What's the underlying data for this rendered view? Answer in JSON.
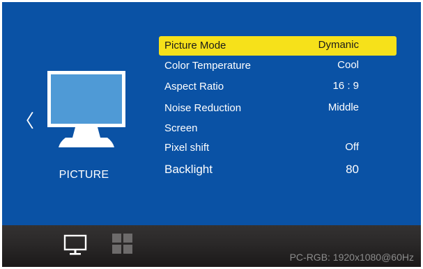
{
  "nav": {
    "back_glyph": "〈"
  },
  "category": {
    "label": "PICTURE",
    "icon": "monitor-icon"
  },
  "menu": [
    {
      "label": "Picture Mode",
      "value": "Dymanic",
      "selected": true
    },
    {
      "label": "Color Temperature",
      "value": "Cool"
    },
    {
      "label": "Aspect Ratio",
      "value": "16 : 9"
    },
    {
      "label": "Noise Reduction",
      "value": "Middle"
    },
    {
      "label": "Screen",
      "value": ""
    },
    {
      "label": "Pixel shift",
      "value": "Off"
    },
    {
      "label": "Backlight",
      "value": "80"
    }
  ],
  "tabs": [
    {
      "icon": "monitor-icon",
      "active": true
    },
    {
      "icon": "grid-icon",
      "active": false
    }
  ],
  "status": {
    "text": "PC-RGB: 1920x1080@60Hz"
  },
  "colors": {
    "background": "#0a52a5",
    "highlight": "#f6e11a",
    "bottom_bar": "#2b2929",
    "status_text": "#8c8c8c"
  }
}
